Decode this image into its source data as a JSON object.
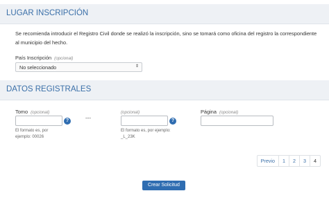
{
  "lugar": {
    "title": "LUGAR INSCRIPCIÓN",
    "intro": "Se recomienda introducir el Registro Civil donde se realizó la inscripción, sino se tomará como oficina del registro la correspondiente al municipio del hecho.",
    "pais_label": "País Inscripción",
    "pais_optional": "(opcional)",
    "pais_value": "No seleccionado"
  },
  "datos": {
    "title": "DATOS REGISTRALES",
    "tomo_label": "Tomo",
    "tomo_optional": "(opcional)",
    "tomo_hint": "El formato es, por ejemplo: 00026",
    "separator": "---",
    "second_optional": "(opcional)",
    "second_hint": "El formato es, por ejemplo: _L_23K",
    "pagina_label": "Página",
    "pagina_optional": "(opcional)",
    "help_glyph": "?"
  },
  "pagination": {
    "prev": "Previo",
    "pages": [
      "1",
      "2",
      "3",
      "4"
    ]
  },
  "submit_label": "Crear Solicitud",
  "colors": {
    "accent": "#2f6db1",
    "header_bg": "#eef1f5",
    "header_text": "#3a6fa8"
  }
}
